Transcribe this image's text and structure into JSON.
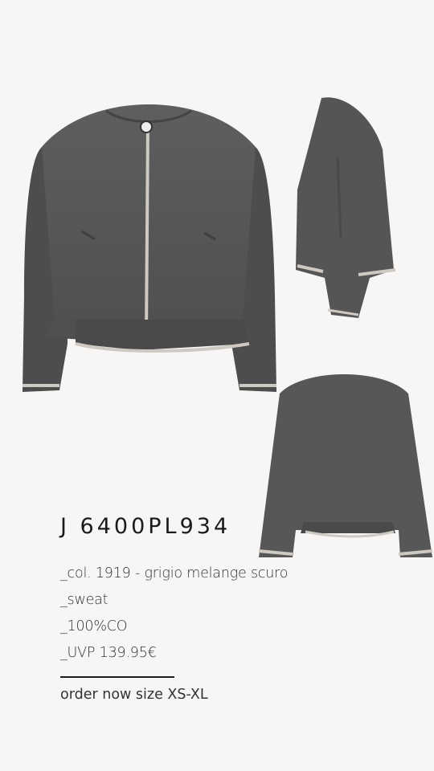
{
  "product": {
    "code": "J 6400PL934",
    "color": "_col. 1919 - grigio melange scuro",
    "material": "_sweat",
    "composition": "_100%CO",
    "price": "_UVP 139.95€",
    "order_text": "order now size XS-XL"
  },
  "images": {
    "front": "front-jacket-image",
    "side": "side-jacket-image",
    "back": "back-jacket-image"
  },
  "colors": {
    "background": "#f8f6f5",
    "jacket": "#555555",
    "trim": "#c9c4be",
    "text": "#1a1a1a"
  }
}
